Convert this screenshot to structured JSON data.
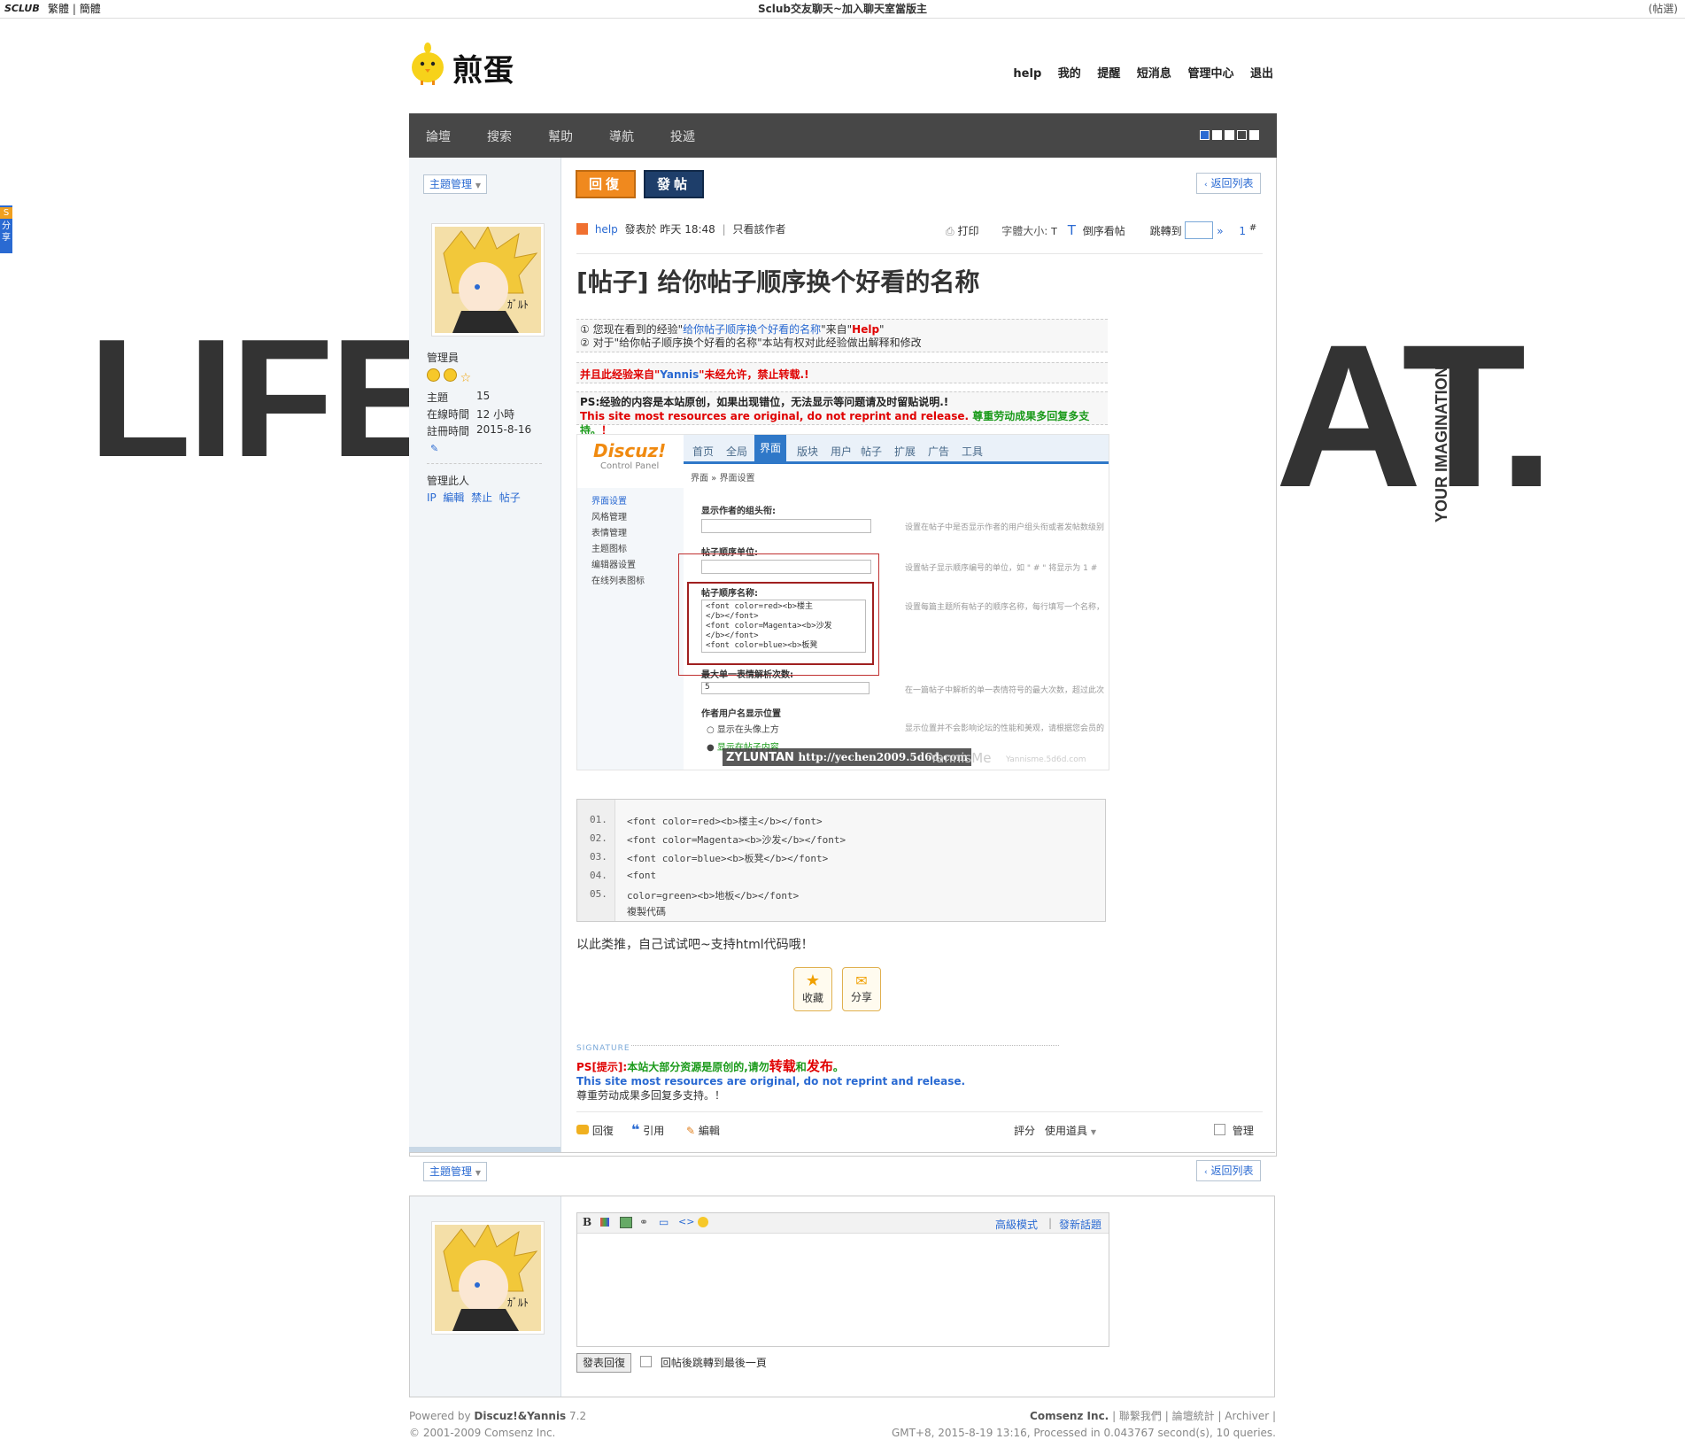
{
  "topbar": {
    "logo": "SCLUB",
    "lang_trad": "繁體",
    "lang_sep": "|",
    "lang_simp": "簡體",
    "title": "Sclub交友聊天~加入聊天室當版主",
    "right": "(帖選)"
  },
  "background_art": {
    "left_word": "LIFE",
    "right_word": "AT.",
    "vertical_text": "YOUR IMAGINATION"
  },
  "brand": {
    "name": "煎蛋"
  },
  "topnav": [
    "help",
    "我的",
    "提醒",
    "短消息",
    "管理中心",
    "退出"
  ],
  "mainnav": {
    "items": [
      "論壇",
      "搜索",
      "幫助",
      "導航",
      "投遞"
    ]
  },
  "thread": {
    "manage_label": "主題管理",
    "reply_btn": "回復",
    "post_btn": "發帖",
    "back_label": "返回列表",
    "author": "help",
    "posted_meta": "發表於 昨天 18:48",
    "sep": "|",
    "only_author": "只看該作者",
    "print": "打印",
    "font_size_label": "字體大小:",
    "font_size_t": "T",
    "font_size_t2": "T",
    "reverse": "倒序看帖",
    "jump_to": "跳轉到",
    "jump_arrow": "»",
    "floor": "1",
    "floor_hash": "#",
    "title": "[帖子] 给你帖子顺序换个好看的名称"
  },
  "user": {
    "role": "管理員",
    "stats": [
      {
        "label": "主題",
        "value": "15"
      },
      {
        "label": "在線時間",
        "value": "12 小時"
      },
      {
        "label": "註冊時間",
        "value": "2015-8-16"
      }
    ],
    "manage_title": "管理此人",
    "manage_links": [
      "IP",
      "編輯",
      "禁止",
      "帖子"
    ]
  },
  "notices": {
    "line1_prefix": "① 您现在看到的经验\"",
    "line1_link": "给你帖子顺序换个好看的名称",
    "line1_mid": "\"来自\"",
    "line1_author": "Help",
    "line1_end": "\"",
    "line2": "② 对于\"给你帖子顺序换个好看的名称\"本站有权对此经验做出解释和修改",
    "line3_prefix": "并且此经验来自\"",
    "line3_author": "Yannis",
    "line3_end": "\"未经允许，禁止转载.!",
    "ps_line1": "PS:经验的内容是本站原创，如果出现错位，无法显示等问题请及时留贴说明.!",
    "ps_line2_red": "This site most resources are original, do not reprint and release.",
    "ps_line2_green": "尊重劳动成果多回复多支持。",
    "ps_line2_end": "！"
  },
  "screenshot": {
    "logo": "Discuz!",
    "logo_sub": "Control Panel",
    "tabs": [
      "首页",
      "全局",
      "界面",
      "版块",
      "用户",
      "帖子",
      "扩展",
      "广告",
      "工具"
    ],
    "breadcrumb": "界面 » 界面设置",
    "left_items": [
      "界面设置",
      "风格管理",
      "表情管理",
      "主题图标",
      "编辑器设置",
      "在线列表图标"
    ],
    "label1": "显示作者的组头衔:",
    "hint1": "设置在帖子中是否显示作者的用户组头衔或者发帖数级别",
    "label2": "帖子顺序单位:",
    "hint2": "设置帖子显示顺序编号的单位，如 \" # \" 将显示为 1 #",
    "label3": "帖子顺序名称:",
    "hint3": "设置每篇主题所有帖子的顺序名称，每行填写一个名称，",
    "textarea_lines": [
      "<font color=red><b>楼主",
      "</b></font>",
      "<font color=Magenta><b>沙发",
      "</b></font>",
      "<font color=blue><b>板凳"
    ],
    "label4": "最大单一表情解析次数:",
    "value4": "5",
    "hint4": "在一篇帖子中解析的单一表情符号的最大次数，超过此次",
    "label5": "作者用户名显示位置",
    "hint5": "显示位置并不会影响论坛的性能和美观，请根据您会员的",
    "radio1": "显示在头像上方",
    "radio2": "显示在帖子内容",
    "watermark1": "ZYLUNTAN",
    "watermark2": "http://yechen2009.5d6d.com",
    "watermark3": "YannisMe",
    "watermark4": "Yannisme.5d6d.com"
  },
  "code": {
    "lines": [
      {
        "n": "01.",
        "text": "<font color=red><b>楼主</b></font>"
      },
      {
        "n": "02.",
        "text": "<font color=Magenta><b>沙发</b></font>"
      },
      {
        "n": "03.",
        "text": "<font color=blue><b>板凳</b></font>"
      },
      {
        "n": "04.",
        "text": "<font"
      },
      {
        "n": "05.",
        "text": "color=green><b>地板</b></font>"
      }
    ],
    "copy": "複製代碼"
  },
  "body_text": "以此类推，自己试试吧~支持html代码哦！",
  "actions": {
    "favorite": "收藏",
    "share": "分享"
  },
  "signature": {
    "label": "SIGNATURE",
    "ps_prefix": "PS[提示]:",
    "line1_mid": "本站大部分资源是原创的,请勿",
    "line1_red1": "转载",
    "line1_and": "和",
    "line1_red2": "发布",
    "line1_end": "。",
    "line2": "This site most resources are original, do not reprint and release.",
    "line3": "尊重劳动成果多回复多支持。！"
  },
  "post_actions": {
    "reply": "回復",
    "quote": "引用",
    "edit": "編輯",
    "rate": "評分",
    "tools": "使用道具",
    "manage": "管理"
  },
  "editor": {
    "advanced": "高級模式",
    "sep": "|",
    "new_topic": "發新話題",
    "submit": "發表回復",
    "jump_last": "回帖後跳轉到最後一頁"
  },
  "footer": {
    "powered_prefix": "Powered by ",
    "powered_name": "Discuz!&Yannis",
    "version": " 7.2",
    "copyright": "© 2001-2009 Comsenz Inc.",
    "company": "Comsenz Inc.",
    "links": [
      "聯繫我們",
      "論壇統計",
      "Archiver"
    ],
    "stats": "GMT+8, 2015-8-19 13:16, Processed in 0.043767 second(s), 10 queries."
  },
  "share_tab": {
    "letter": "S",
    "text": "分享"
  },
  "colors": {
    "nav_bg": "#474747",
    "link": "#2a6ad2",
    "orange": "#f0891e",
    "navy": "#1e3e6a",
    "red": "#e00000",
    "green": "#1a9a1a"
  }
}
